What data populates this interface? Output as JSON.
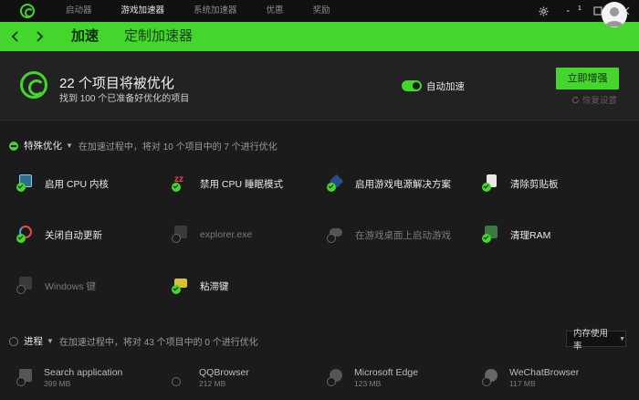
{
  "titlebar": {
    "tabs": [
      "启动器",
      "游戏加速器",
      "系统加速器",
      "优惠",
      "奖励"
    ],
    "active_tab": 1
  },
  "nav": {
    "tab_boost": "加速",
    "tab_custom": "定制加速器",
    "notification_count": "1"
  },
  "boost": {
    "title": "22 个项目将被优化",
    "subtitle": "找到 100 个已准备好优化的项目",
    "auto_boost_label": "自动加速",
    "auto_boost_on": true,
    "boost_button": "立即增强",
    "restore_label": "恢复设置"
  },
  "special": {
    "title": "特殊优化",
    "description": "在加速过程中，将对 10 个项目中的 7 个进行优化",
    "items": [
      {
        "label": "启用 CPU 内核",
        "checked": true,
        "icon": "cpu-core-icon"
      },
      {
        "label": "禁用 CPU 睡眠模式",
        "checked": true,
        "icon": "sleep-zz-icon"
      },
      {
        "label": "启用游戏电源解决方案",
        "checked": true,
        "icon": "power-plan-icon"
      },
      {
        "label": "清除剪贴板",
        "checked": true,
        "icon": "clipboard-icon"
      },
      {
        "label": "关闭自动更新",
        "checked": true,
        "icon": "update-icon"
      },
      {
        "label": "explorer.exe",
        "checked": false,
        "icon": "explorer-icon"
      },
      {
        "label": "在游戏桌面上启动游戏",
        "checked": false,
        "icon": "gamepad-icon"
      },
      {
        "label": "清理RAM",
        "checked": true,
        "icon": "ram-icon"
      },
      {
        "label": "Windows 键",
        "checked": false,
        "icon": "windows-key-icon"
      },
      {
        "label": "粘滞键",
        "checked": true,
        "icon": "sticky-keys-icon"
      }
    ]
  },
  "processes": {
    "title": "进程",
    "description": "在加速过程中，将对 43 个项目中的 0 个进行优化",
    "sort_label": "内存使用率",
    "items": [
      {
        "name": "Search application",
        "mem": "399 MB",
        "icon": "search-app-icon"
      },
      {
        "name": "QQBrowser",
        "mem": "212 MB",
        "icon": "qqbrowser-icon"
      },
      {
        "name": "Microsoft Edge",
        "mem": "123 MB",
        "icon": "edge-icon"
      },
      {
        "name": "WeChatBrowser",
        "mem": "117 MB",
        "icon": "wechat-icon"
      }
    ]
  },
  "colors": {
    "accent": "#44d62c",
    "background": "#1b1b1b",
    "panel": "#222222"
  }
}
